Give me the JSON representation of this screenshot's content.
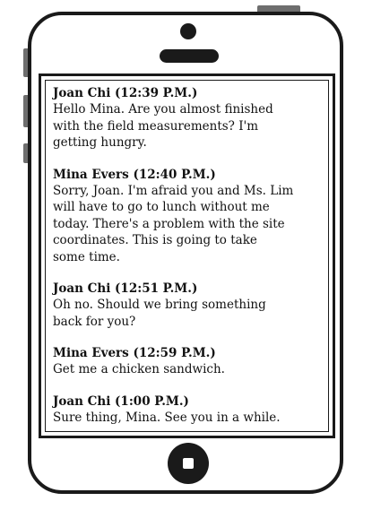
{
  "messages": [
    {
      "sender": "Joan Chi (12:39 P.M.)",
      "text": "Hello Mina. Are you almost finished\nwith the field measurements? I'm\ngetting hungry."
    },
    {
      "sender": "Mina Evers (12:40 P.M.)",
      "text": "Sorry, Joan. I'm afraid you and Ms. Lim\nwill have to go to lunch without me\ntoday. There's a problem with the site\ncoordinates. This is going to take\nsome time."
    },
    {
      "sender": "Joan Chi (12:51 P.M.)",
      "text": "Oh no. Should we bring something\nback for you?"
    },
    {
      "sender": "Mina Evers (12:59 P.M.)",
      "text": "Get me a chicken sandwich."
    },
    {
      "sender": "Joan Chi (1:00 P.M.)",
      "text": "Sure thing, Mina. See you in a while."
    }
  ],
  "icons": {
    "camera": "camera-icon",
    "speaker": "speaker-icon",
    "home": "home-button-icon"
  },
  "colors": {
    "frame": "#1a1a1a",
    "buttons": "#6e6e6e",
    "screen": "#ffffff"
  }
}
